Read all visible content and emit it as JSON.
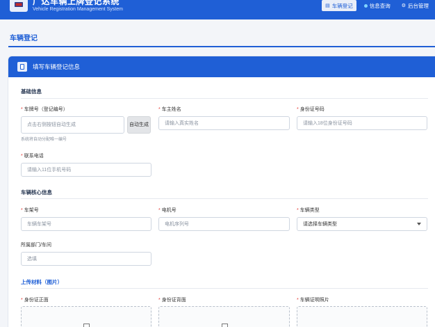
{
  "header": {
    "title": "广达车辆上牌登记系统",
    "subtitle": "Vehicle Registration Management System",
    "nav": [
      {
        "label": "车辆登记",
        "icon": "document-icon",
        "active": true
      },
      {
        "label": "信息查询",
        "icon": "dot-icon",
        "active": false
      },
      {
        "label": "后台管理",
        "icon": "gear-icon",
        "active": false
      }
    ]
  },
  "page": {
    "title": "车辆登记"
  },
  "card": {
    "title": "填写车辆登记信息"
  },
  "sections": {
    "basic": "基础信息",
    "core": "车辆核心信息",
    "upload": "上传材料（图片）"
  },
  "fields": {
    "plate": {
      "label": "车牌号（登记编号）",
      "placeholder": "点击右侧按钮自动生成",
      "button": "自动生成",
      "hint": "系统将自动分配唯一编号"
    },
    "owner": {
      "label": "车主姓名",
      "placeholder": "请输入真实姓名"
    },
    "idcard": {
      "label": "身份证号码",
      "placeholder": "请输入18位身份证号码"
    },
    "phone": {
      "label": "联系电话",
      "placeholder": "请输入11位手机号码"
    },
    "vin": {
      "label": "车架号",
      "placeholder": "车辆车架号"
    },
    "motor": {
      "label": "电机号",
      "placeholder": "电机序列号"
    },
    "type": {
      "label": "车辆类型",
      "value": "请选择车辆类型"
    },
    "dept": {
      "label": "所属部门/车间",
      "placeholder": "选填"
    }
  },
  "uploads": [
    {
      "label": "身份证正面"
    },
    {
      "label": "身份证背面"
    },
    {
      "label": "车辆证明照片"
    }
  ],
  "required_mark": "*"
}
